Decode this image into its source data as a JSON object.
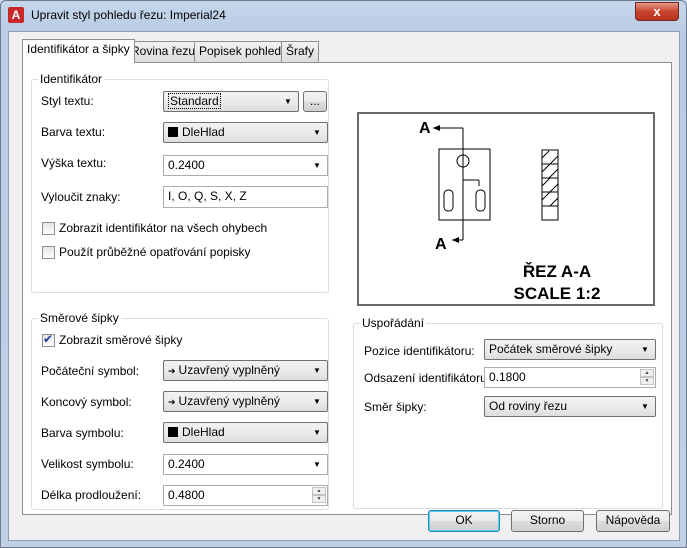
{
  "window": {
    "title": "Upravit styl pohledu řezu: Imperial24",
    "close_symbol": "x"
  },
  "tabs": [
    "Identifikátor a šipky",
    "Rovina řezu",
    "Popisek pohledu",
    "Šrafy"
  ],
  "identifier_group": {
    "title": "Identifikátor",
    "text_style_label": "Styl textu:",
    "text_style_value": "Standard",
    "browse_label": "...",
    "text_color_label": "Barva textu:",
    "text_color_value": "DleHlad",
    "text_height_label": "Výška textu:",
    "text_height_value": "0.2400",
    "exclude_label": "Vyloučit znaky:",
    "exclude_value": "I, O, Q, S, X, Z",
    "show_at_bends_label": "Zobrazit identifikátor na všech ohybech",
    "continuous_label": "Použít průběžné opatřování popisky"
  },
  "arrows_group": {
    "title": "Směrové šipky",
    "show_arrows_label": "Zobrazit směrové šipky",
    "start_symbol_label": "Počáteční symbol:",
    "start_symbol_value": "Uzavřený vyplněný",
    "end_symbol_label": "Koncový symbol:",
    "end_symbol_value": "Uzavřený vyplněný",
    "symbol_color_label": "Barva symbolu:",
    "symbol_color_value": "DleHlad",
    "symbol_size_label": "Velikost symbolu:",
    "symbol_size_value": "0.2400",
    "extension_label": "Délka prodloužení:",
    "extension_value": "0.4800"
  },
  "layout_group": {
    "title": "Uspořádání",
    "position_label": "Pozice identifikátoru:",
    "position_value": "Počátek směrové šipky",
    "offset_label": "Odsazení identifikátoru:",
    "offset_value": "0.1800",
    "direction_label": "Směr šipky:",
    "direction_value": "Od roviny řezu"
  },
  "preview": {
    "label_a_top": "A",
    "label_a_bottom": "A",
    "section_title": "ŘEZ A-A",
    "scale_text": "SCALE 1:2"
  },
  "buttons": {
    "ok": "OK",
    "cancel": "Storno",
    "help": "Nápověda"
  },
  "colors": {
    "accent": "#3c7fb1",
    "close": "#c9442d",
    "app_icon": "#c8282b"
  }
}
